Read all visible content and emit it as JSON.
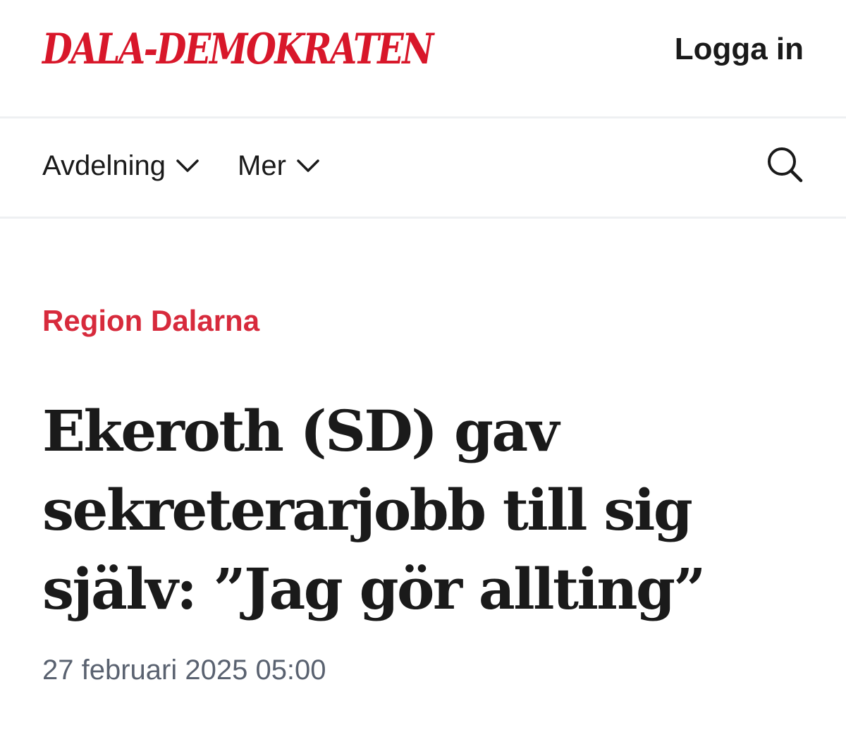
{
  "header": {
    "logo_text": "DALA-DEMOKRATEN",
    "login_label": "Logga in",
    "brand_color": "#d8172a"
  },
  "nav": {
    "items": [
      {
        "label": "Avdelning",
        "icon": "chevron-down-icon"
      },
      {
        "label": "Mer",
        "icon": "chevron-down-icon"
      }
    ],
    "search_icon": "search-icon"
  },
  "article": {
    "section": "Region Dalarna",
    "section_color": "#d72a3c",
    "headline_lines": [
      "Ekeroth (SD) gav",
      "sekreterarjobb till sig",
      "själv: ”Jag gör allting”"
    ],
    "published": "27 februari 2025 05:00"
  }
}
